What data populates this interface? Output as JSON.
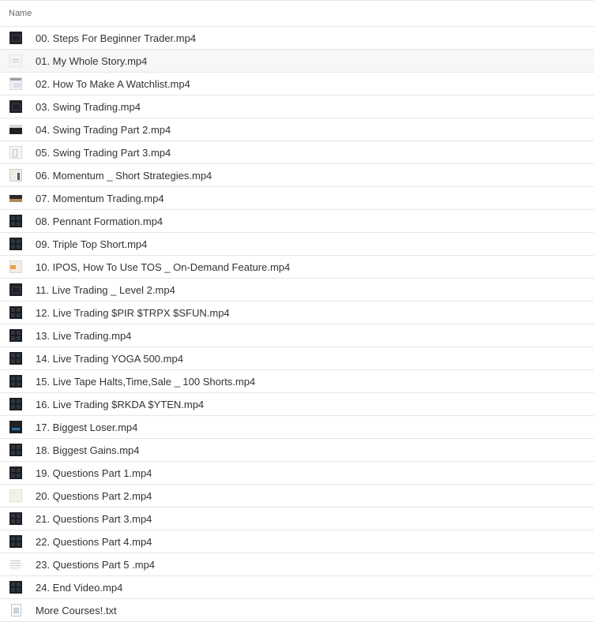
{
  "header": {
    "name_label": "Name"
  },
  "files": [
    {
      "name": "00. Steps For Beginner Trader.mp4",
      "thumb": "dark"
    },
    {
      "name": "01. My Whole Story.mp4",
      "thumb": "light"
    },
    {
      "name": "02. How To Make A Watchlist.mp4",
      "thumb": "window"
    },
    {
      "name": "03. Swing Trading.mp4",
      "thumb": "dark"
    },
    {
      "name": "04. Swing Trading Part 2.mp4",
      "thumb": "bar"
    },
    {
      "name": "05. Swing Trading Part 3.mp4",
      "thumb": "page"
    },
    {
      "name": "06. Momentum _ Short Strategies.mp4",
      "thumb": "page2"
    },
    {
      "name": "07. Momentum Trading.mp4",
      "thumb": "strip"
    },
    {
      "name": "08. Pennant Formation.mp4",
      "thumb": "grid"
    },
    {
      "name": "09. Triple Top Short.mp4",
      "thumb": "grid"
    },
    {
      "name": "10. IPOS, How To Use TOS _ On-Demand Feature.mp4",
      "thumb": "orange"
    },
    {
      "name": "11. Live Trading _ Level 2.mp4",
      "thumb": "dark"
    },
    {
      "name": "12. Live Trading $PIR $TRPX $SFUN.mp4",
      "thumb": "grid"
    },
    {
      "name": "13. Live Trading.mp4",
      "thumb": "grid"
    },
    {
      "name": "14. Live Trading YOGA 500.mp4",
      "thumb": "grid"
    },
    {
      "name": "15. Live Tape Halts,Time,Sale _ 100 Shorts.mp4",
      "thumb": "grid"
    },
    {
      "name": "16. Live Trading $RKDA $YTEN.mp4",
      "thumb": "grid"
    },
    {
      "name": "17. Biggest Loser.mp4",
      "thumb": "blue"
    },
    {
      "name": "18. Biggest Gains.mp4",
      "thumb": "grid"
    },
    {
      "name": "19. Questions Part 1.mp4",
      "thumb": "grid"
    },
    {
      "name": "20. Questions Part 2.mp4",
      "thumb": "cream"
    },
    {
      "name": "21. Questions Part 3.mp4",
      "thumb": "grid"
    },
    {
      "name": "22. Questions Part 4.mp4",
      "thumb": "grid"
    },
    {
      "name": "23. Questions Part 5 .mp4",
      "thumb": "notes"
    },
    {
      "name": "24. End Video.mp4",
      "thumb": "grid"
    },
    {
      "name": "More Courses!.txt",
      "thumb": "txt"
    }
  ],
  "selected_index": 1
}
